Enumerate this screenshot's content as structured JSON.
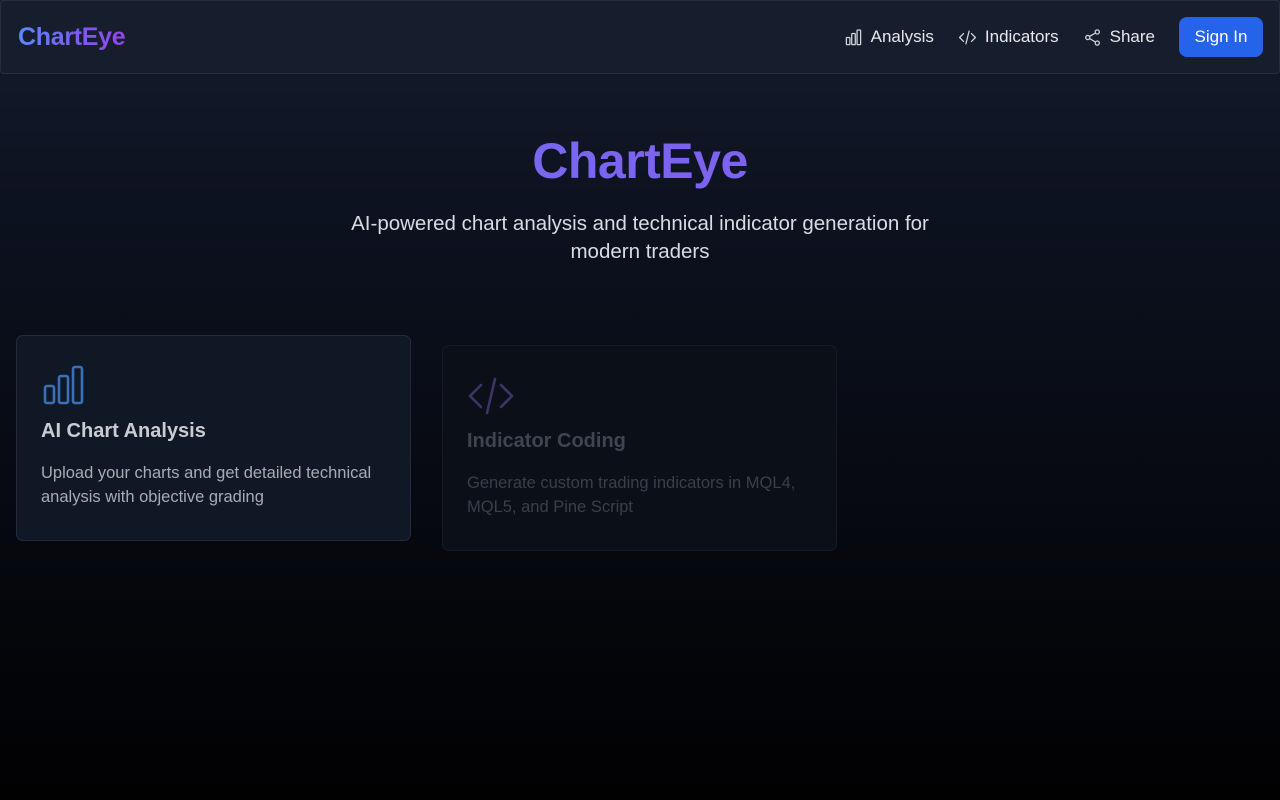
{
  "nav": {
    "brand": "ChartEye",
    "links": [
      {
        "label": "Analysis",
        "icon": "bar-chart-icon"
      },
      {
        "label": "Indicators",
        "icon": "code-icon"
      },
      {
        "label": "Share",
        "icon": "share-icon"
      }
    ],
    "signin_label": "Sign In"
  },
  "hero": {
    "title": "ChartEye",
    "subtitle": "AI-powered chart analysis and technical indicator generation for modern traders"
  },
  "features": [
    {
      "icon": "bar-chart-icon",
      "title": "AI Chart Analysis",
      "description": "Upload your charts and get detailed technical analysis with objective grading"
    },
    {
      "icon": "code-icon",
      "title": "Indicator Coding",
      "description": "Generate custom trading indicators in MQL4, MQL5, and Pine Script"
    }
  ],
  "colors": {
    "accent": "#2563eb",
    "brand_gradient_start": "#5b8af5",
    "brand_gradient_end": "#9446e8",
    "card_icon_blue": "#3b6fb8",
    "card_icon_purple": "#3e3566"
  }
}
